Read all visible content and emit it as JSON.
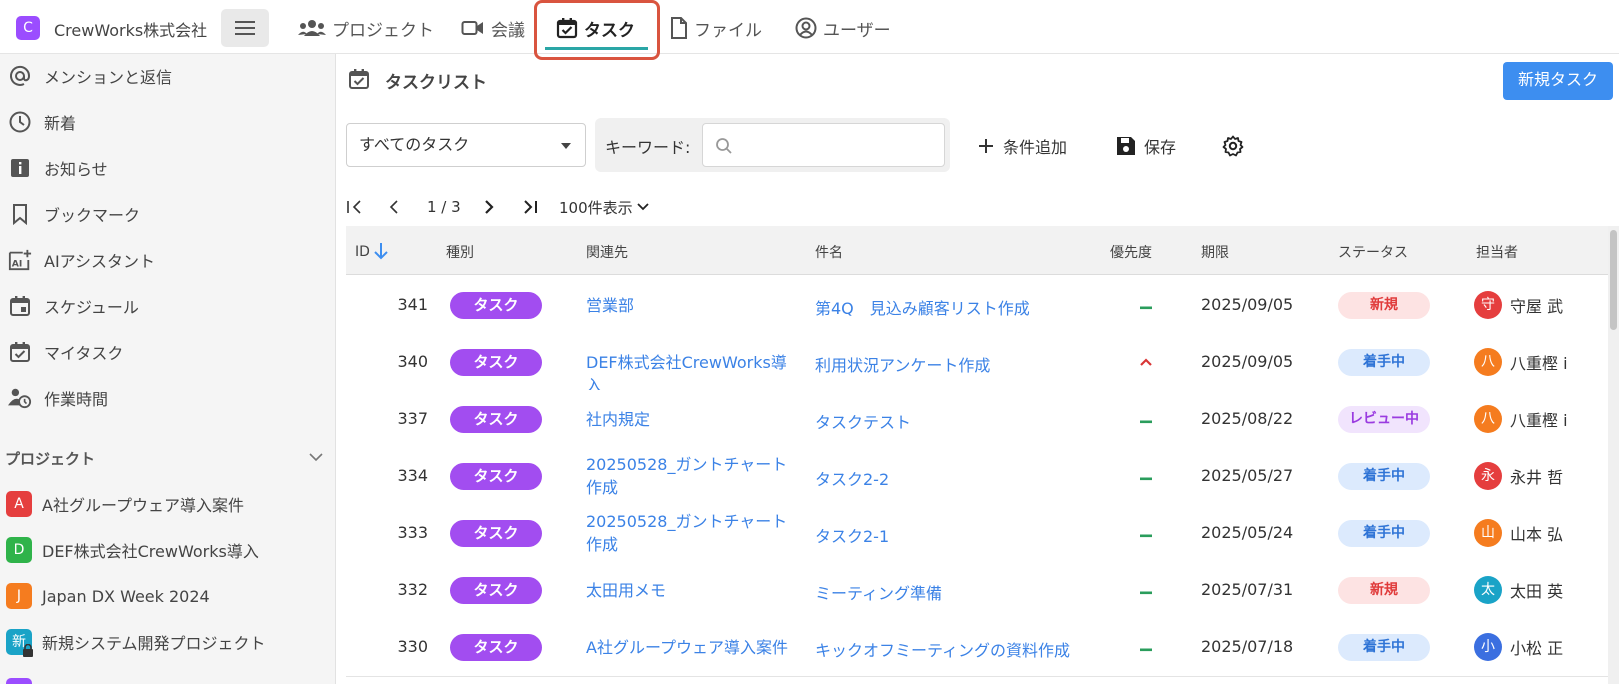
{
  "app": {
    "brand_initial": "C",
    "brand_name": "CrewWorks株式会社"
  },
  "nav": {
    "tabs": [
      {
        "label": "プロジェクト",
        "icon": "users-icon"
      },
      {
        "label": "会議",
        "icon": "video-icon"
      },
      {
        "label": "タスク",
        "icon": "calendar-check-icon",
        "active": true
      },
      {
        "label": "ファイル",
        "icon": "file-icon"
      },
      {
        "label": "ユーザー",
        "icon": "user-circle-icon"
      }
    ]
  },
  "sidebar": {
    "items": [
      {
        "label": "メンションと返信",
        "icon": "at-icon"
      },
      {
        "label": "新着",
        "icon": "clock-icon"
      },
      {
        "label": "お知らせ",
        "icon": "info-icon"
      },
      {
        "label": "ブックマーク",
        "icon": "bookmark-icon"
      },
      {
        "label": "AIアシスタント",
        "icon": "ai-assistant-icon"
      },
      {
        "label": "スケジュール",
        "icon": "calendar-icon"
      },
      {
        "label": "マイタスク",
        "icon": "calendar-check-icon"
      },
      {
        "label": "作業時間",
        "icon": "user-clock-icon"
      }
    ],
    "projects_heading": "プロジェクト",
    "projects": [
      {
        "initial": "A",
        "label": "A社グループウェア導入案件",
        "color": "#e53e3e"
      },
      {
        "initial": "D",
        "label": "DEF株式会社CrewWorks導入",
        "color": "#2fb34a"
      },
      {
        "initial": "J",
        "label": "Japan DX Week 2024",
        "color": "#f57c1f"
      },
      {
        "initial": "新",
        "label": "新規システム開発プロジェクト",
        "color": "#1aa3c7",
        "locked": true
      }
    ]
  },
  "main": {
    "title": "タスクリスト",
    "new_task_label": "新規タスク",
    "filter_value": "すべてのタスク",
    "keyword_label": "キーワード:",
    "keyword_value": "",
    "add_condition_label": "条件追加",
    "save_label": "保存",
    "pager": {
      "page_text": "1 / 3",
      "per_page_label": "100件表示"
    }
  },
  "table": {
    "columns": {
      "id": "ID",
      "type": "種別",
      "related": "関連先",
      "subject": "件名",
      "priority": "優先度",
      "due": "期限",
      "status": "ステータス",
      "assignee": "担当者"
    },
    "rows": [
      {
        "id": "341",
        "type": "タスク",
        "related": "営業部",
        "subject": "第4Q　見込み顧客リスト作成",
        "priority": "—",
        "priority_kind": "normal",
        "due": "2025/09/05",
        "status": "新規",
        "status_kind": "new",
        "avatar": "守",
        "avatar_color": "#e53e3e",
        "assignee": "守屋 武"
      },
      {
        "id": "340",
        "type": "タスク",
        "related": "DEF株式会社CrewWorks導入",
        "subject": "利用状況アンケート作成",
        "priority": "^",
        "priority_kind": "high",
        "due": "2025/09/05",
        "status": "着手中",
        "status_kind": "progress",
        "avatar": "八",
        "avatar_color": "#f57c1f",
        "assignee": "八重樫 i"
      },
      {
        "id": "337",
        "type": "タスク",
        "related": "社内規定",
        "subject": "タスクテスト",
        "priority": "—",
        "priority_kind": "normal",
        "due": "2025/08/22",
        "status": "レビュー中",
        "status_kind": "review",
        "avatar": "八",
        "avatar_color": "#f57c1f",
        "assignee": "八重樫 i"
      },
      {
        "id": "334",
        "type": "タスク",
        "related": "20250528_ガントチャート作成",
        "subject": "タスク2-2",
        "priority": "—",
        "priority_kind": "normal",
        "due": "2025/05/27",
        "status": "着手中",
        "status_kind": "progress",
        "avatar": "永",
        "avatar_color": "#e53e3e",
        "assignee": "永井 哲"
      },
      {
        "id": "333",
        "type": "タスク",
        "related": "20250528_ガントチャート作成",
        "subject": "タスク2-1",
        "priority": "—",
        "priority_kind": "normal",
        "due": "2025/05/24",
        "status": "着手中",
        "status_kind": "progress",
        "avatar": "山",
        "avatar_color": "#f57c1f",
        "assignee": "山本 弘"
      },
      {
        "id": "332",
        "type": "タスク",
        "related": "太田用メモ",
        "subject": "ミーティング準備",
        "priority": "—",
        "priority_kind": "normal",
        "due": "2025/07/31",
        "status": "新規",
        "status_kind": "new",
        "avatar": "太",
        "avatar_color": "#1aa3c7",
        "assignee": "太田 英"
      },
      {
        "id": "330",
        "type": "タスク",
        "related": "A社グループウェア導入案件",
        "subject": "キックオフミーティングの資料作成",
        "priority": "—",
        "priority_kind": "normal",
        "due": "2025/07/18",
        "status": "着手中",
        "status_kind": "progress",
        "avatar": "小",
        "avatar_color": "#3b6fe0",
        "assignee": "小松 正"
      }
    ]
  },
  "colors": {
    "accent": "#3d8ef0",
    "tag_purple": "#a24df0",
    "link": "#3b82e6",
    "status_new_bg": "#fde3e3",
    "status_new_fg": "#e03b3b",
    "status_progress_bg": "#dceafd",
    "status_progress_fg": "#2f74d6",
    "status_review_bg": "#f1e4fd",
    "status_review_fg": "#9a3be0",
    "priority_normal": "#2a9d5c",
    "priority_high": "#d93636",
    "highlight": "#d9543f"
  }
}
